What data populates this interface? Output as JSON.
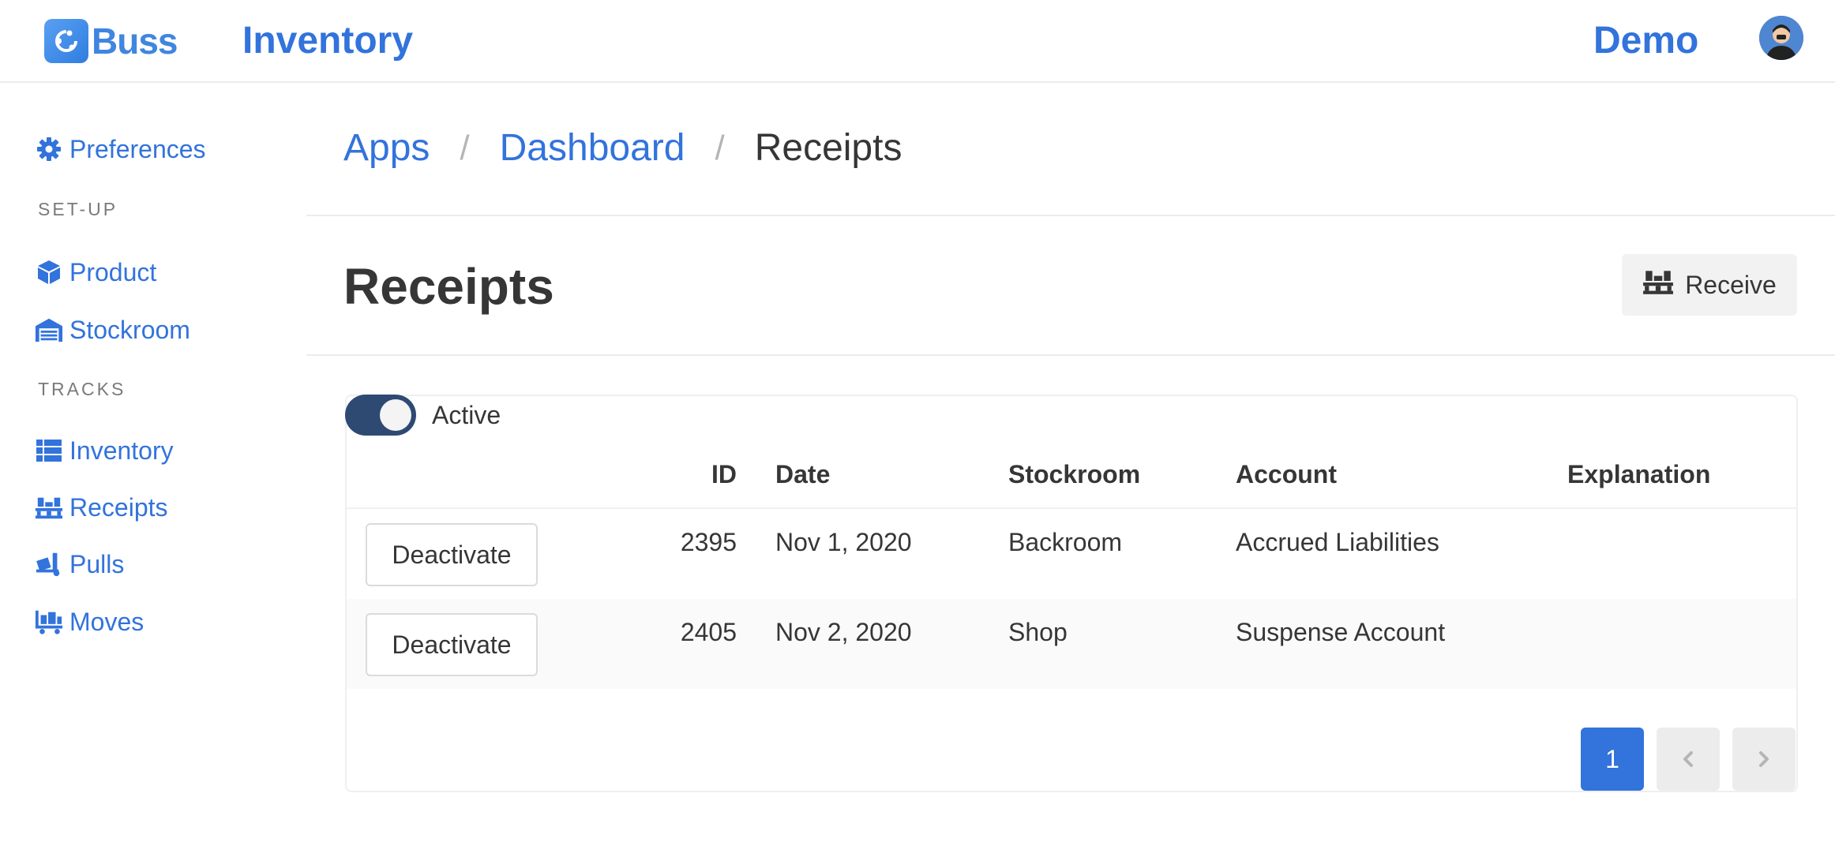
{
  "header": {
    "brand": "Buss",
    "app_title": "Inventory",
    "user_name": "Demo"
  },
  "sidebar": {
    "preferences": "Preferences",
    "setup_label": "SET-UP",
    "setup_items": [
      {
        "label": "Product",
        "icon": "cube-icon"
      },
      {
        "label": "Stockroom",
        "icon": "warehouse-icon"
      }
    ],
    "tracks_label": "TRACKS",
    "tracks_items": [
      {
        "label": "Inventory",
        "icon": "list-icon"
      },
      {
        "label": "Receipts",
        "icon": "pallet-icon"
      },
      {
        "label": "Pulls",
        "icon": "dolly-icon"
      },
      {
        "label": "Moves",
        "icon": "cart-icon"
      }
    ]
  },
  "breadcrumb": {
    "items": [
      "Apps",
      "Dashboard"
    ],
    "separator": "/",
    "current": "Receipts"
  },
  "page": {
    "title": "Receipts",
    "receive_label": "Receive"
  },
  "filter": {
    "active_label": "Active",
    "active_on": true
  },
  "table": {
    "columns": [
      "ID",
      "Date",
      "Stockroom",
      "Account",
      "Explanation"
    ],
    "rows": [
      {
        "action": "Deactivate",
        "id": "2395",
        "date": "Nov 1, 2020",
        "stockroom": "Backroom",
        "account": "Accrued Liabilities",
        "explanation": ""
      },
      {
        "action": "Deactivate",
        "id": "2405",
        "date": "Nov 2, 2020",
        "stockroom": "Shop",
        "account": "Suspense Account",
        "explanation": ""
      }
    ]
  },
  "pagination": {
    "current": "1",
    "prev": "‹",
    "next": "›"
  },
  "colors": {
    "accent": "#3273dc",
    "toggle": "#2e4a73",
    "text": "#363636"
  }
}
